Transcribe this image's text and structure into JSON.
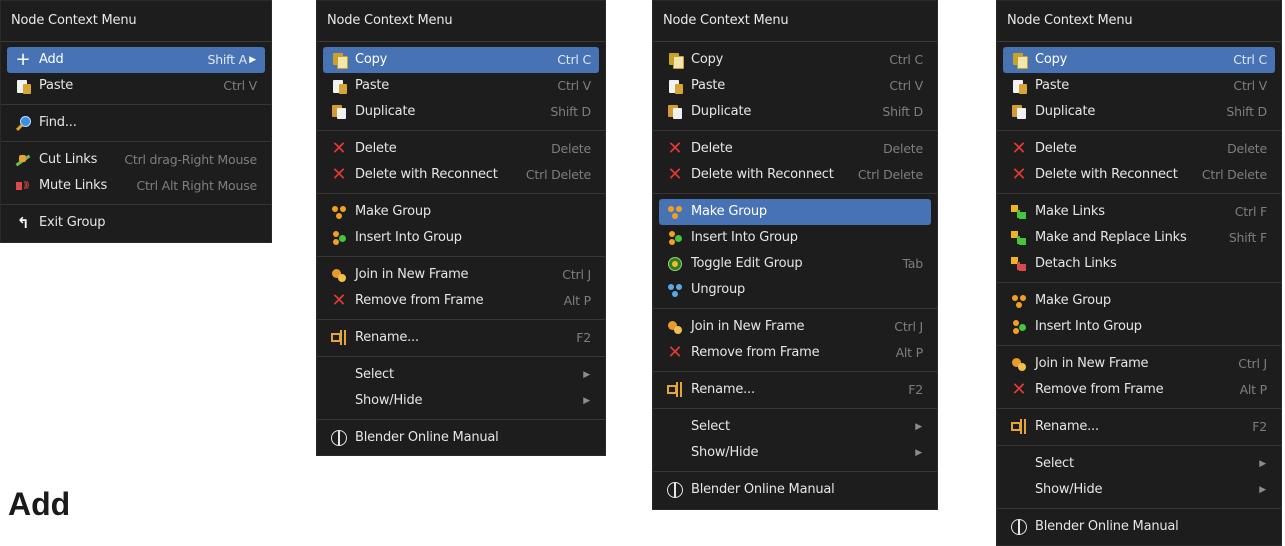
{
  "heading": "Add",
  "menus": [
    {
      "title": "Node Context Menu",
      "items": [
        {
          "type": "item",
          "icon": "add-icon",
          "label": "Add",
          "shortcut": "Shift A",
          "submenu": true,
          "active": true
        },
        {
          "type": "item",
          "icon": "paste-icon",
          "label": "Paste",
          "shortcut": "Ctrl V"
        },
        {
          "type": "sep"
        },
        {
          "type": "item",
          "icon": "find-icon",
          "label": "Find...",
          "shortcut": ""
        },
        {
          "type": "sep"
        },
        {
          "type": "item",
          "icon": "cut-links-icon",
          "label": "Cut Links",
          "shortcut": "Ctrl drag-Right Mouse"
        },
        {
          "type": "item",
          "icon": "mute-links-icon",
          "label": "Mute Links",
          "shortcut": "Ctrl Alt Right Mouse"
        },
        {
          "type": "sep"
        },
        {
          "type": "item",
          "icon": "exit-group-icon",
          "label": "Exit Group",
          "shortcut": ""
        }
      ]
    },
    {
      "title": "Node Context Menu",
      "items": [
        {
          "type": "item",
          "icon": "copy-icon",
          "label": "Copy",
          "shortcut": "Ctrl C",
          "active": true
        },
        {
          "type": "item",
          "icon": "paste-icon",
          "label": "Paste",
          "shortcut": "Ctrl V"
        },
        {
          "type": "item",
          "icon": "duplicate-icon",
          "label": "Duplicate",
          "shortcut": "Shift D"
        },
        {
          "type": "sep"
        },
        {
          "type": "item",
          "icon": "delete-icon",
          "label": "Delete",
          "shortcut": "Delete"
        },
        {
          "type": "item",
          "icon": "delete-icon",
          "label": "Delete with Reconnect",
          "shortcut": "Ctrl Delete"
        },
        {
          "type": "sep"
        },
        {
          "type": "item",
          "icon": "make-group-icon",
          "label": "Make Group",
          "shortcut": ""
        },
        {
          "type": "item",
          "icon": "insert-group-icon",
          "label": "Insert Into Group",
          "shortcut": ""
        },
        {
          "type": "sep"
        },
        {
          "type": "item",
          "icon": "join-frame-icon",
          "label": "Join in New Frame",
          "shortcut": "Ctrl J"
        },
        {
          "type": "item",
          "icon": "delete-icon",
          "label": "Remove from Frame",
          "shortcut": "Alt P"
        },
        {
          "type": "sep"
        },
        {
          "type": "item",
          "icon": "rename-icon",
          "label": "Rename...",
          "shortcut": "F2"
        },
        {
          "type": "sep"
        },
        {
          "type": "item",
          "icon": "",
          "label": "Select",
          "shortcut": "",
          "submenu": true
        },
        {
          "type": "item",
          "icon": "",
          "label": "Show/Hide",
          "shortcut": "",
          "submenu": true
        },
        {
          "type": "sep"
        },
        {
          "type": "item",
          "icon": "manual-icon",
          "label": "Blender Online Manual",
          "shortcut": ""
        }
      ]
    },
    {
      "title": "Node Context Menu",
      "items": [
        {
          "type": "item",
          "icon": "copy-icon",
          "label": "Copy",
          "shortcut": "Ctrl C"
        },
        {
          "type": "item",
          "icon": "paste-icon",
          "label": "Paste",
          "shortcut": "Ctrl V"
        },
        {
          "type": "item",
          "icon": "duplicate-icon",
          "label": "Duplicate",
          "shortcut": "Shift D"
        },
        {
          "type": "sep"
        },
        {
          "type": "item",
          "icon": "delete-icon",
          "label": "Delete",
          "shortcut": "Delete"
        },
        {
          "type": "item",
          "icon": "delete-icon",
          "label": "Delete with Reconnect",
          "shortcut": "Ctrl Delete"
        },
        {
          "type": "sep"
        },
        {
          "type": "item",
          "icon": "make-group-icon",
          "label": "Make Group",
          "shortcut": "",
          "active": true
        },
        {
          "type": "item",
          "icon": "insert-group-icon",
          "label": "Insert Into Group",
          "shortcut": ""
        },
        {
          "type": "item",
          "icon": "toggle-edit-group-icon",
          "label": "Toggle Edit Group",
          "shortcut": "Tab"
        },
        {
          "type": "item",
          "icon": "ungroup-icon",
          "label": "Ungroup",
          "shortcut": ""
        },
        {
          "type": "sep"
        },
        {
          "type": "item",
          "icon": "join-frame-icon",
          "label": "Join in New Frame",
          "shortcut": "Ctrl J"
        },
        {
          "type": "item",
          "icon": "delete-icon",
          "label": "Remove from Frame",
          "shortcut": "Alt P"
        },
        {
          "type": "sep"
        },
        {
          "type": "item",
          "icon": "rename-icon",
          "label": "Rename...",
          "shortcut": "F2"
        },
        {
          "type": "sep"
        },
        {
          "type": "item",
          "icon": "",
          "label": "Select",
          "shortcut": "",
          "submenu": true
        },
        {
          "type": "item",
          "icon": "",
          "label": "Show/Hide",
          "shortcut": "",
          "submenu": true
        },
        {
          "type": "sep"
        },
        {
          "type": "item",
          "icon": "manual-icon",
          "label": "Blender Online Manual",
          "shortcut": ""
        }
      ]
    },
    {
      "title": "Node Context Menu",
      "items": [
        {
          "type": "item",
          "icon": "copy-icon",
          "label": "Copy",
          "shortcut": "Ctrl C",
          "active": true
        },
        {
          "type": "item",
          "icon": "paste-icon",
          "label": "Paste",
          "shortcut": "Ctrl V"
        },
        {
          "type": "item",
          "icon": "duplicate-icon",
          "label": "Duplicate",
          "shortcut": "Shift D"
        },
        {
          "type": "sep"
        },
        {
          "type": "item",
          "icon": "delete-icon",
          "label": "Delete",
          "shortcut": "Delete"
        },
        {
          "type": "item",
          "icon": "delete-icon",
          "label": "Delete with Reconnect",
          "shortcut": "Ctrl Delete"
        },
        {
          "type": "sep"
        },
        {
          "type": "item",
          "icon": "make-links-icon",
          "label": "Make Links",
          "shortcut": "Ctrl F"
        },
        {
          "type": "item",
          "icon": "make-links-icon",
          "label": "Make and Replace Links",
          "shortcut": "Shift F"
        },
        {
          "type": "item",
          "icon": "detach-links-icon",
          "label": "Detach Links",
          "shortcut": ""
        },
        {
          "type": "sep"
        },
        {
          "type": "item",
          "icon": "make-group-icon",
          "label": "Make Group",
          "shortcut": ""
        },
        {
          "type": "item",
          "icon": "insert-group-icon",
          "label": "Insert Into Group",
          "shortcut": ""
        },
        {
          "type": "sep"
        },
        {
          "type": "item",
          "icon": "join-frame-icon",
          "label": "Join in New Frame",
          "shortcut": "Ctrl J"
        },
        {
          "type": "item",
          "icon": "delete-icon",
          "label": "Remove from Frame",
          "shortcut": "Alt P"
        },
        {
          "type": "sep"
        },
        {
          "type": "item",
          "icon": "rename-icon",
          "label": "Rename...",
          "shortcut": "F2"
        },
        {
          "type": "sep"
        },
        {
          "type": "item",
          "icon": "",
          "label": "Select",
          "shortcut": "",
          "submenu": true
        },
        {
          "type": "item",
          "icon": "",
          "label": "Show/Hide",
          "shortcut": "",
          "submenu": true
        },
        {
          "type": "sep"
        },
        {
          "type": "item",
          "icon": "manual-icon",
          "label": "Blender Online Manual",
          "shortcut": ""
        }
      ]
    }
  ]
}
